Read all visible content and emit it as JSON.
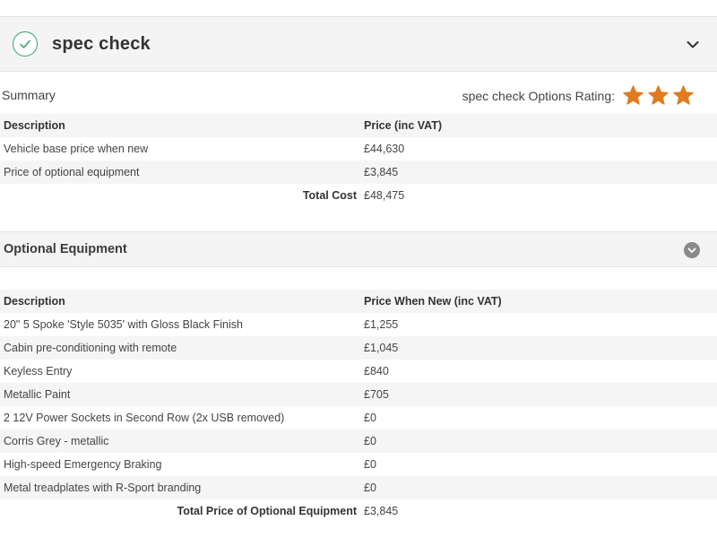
{
  "header": {
    "title": "spec check"
  },
  "summary": {
    "label": "Summary",
    "rating_label": "spec check Options Rating:",
    "rating_stars": 3,
    "rating_color": "#e07b1f",
    "table": {
      "col_description": "Description",
      "col_price": "Price (inc VAT)",
      "rows": [
        {
          "description": "Vehicle base price when new",
          "price": "£44,630"
        },
        {
          "description": "Price of optional equipment",
          "price": "£3,845"
        }
      ],
      "total_label": "Total Cost",
      "total_value": "£48,475"
    }
  },
  "optional_equipment": {
    "title": "Optional Equipment",
    "table": {
      "col_description": "Description",
      "col_price": "Price When New (inc VAT)",
      "rows": [
        {
          "description": "20\" 5 Spoke 'Style 5035' with Gloss Black Finish",
          "price": "£1,255"
        },
        {
          "description": "Cabin pre-conditioning with remote",
          "price": "£1,045"
        },
        {
          "description": "Keyless Entry",
          "price": "£840"
        },
        {
          "description": "Metallic Paint",
          "price": "£705"
        },
        {
          "description": "2 12V Power Sockets in Second Row (2x USB removed)",
          "price": "£0"
        },
        {
          "description": "Corris Grey - metallic",
          "price": "£0"
        },
        {
          "description": "High-speed Emergency Braking",
          "price": "£0"
        },
        {
          "description": "Metal treadplates with R-Sport branding",
          "price": "£0"
        }
      ],
      "total_label": "Total Price of Optional Equipment",
      "total_value": "£3,845"
    }
  }
}
